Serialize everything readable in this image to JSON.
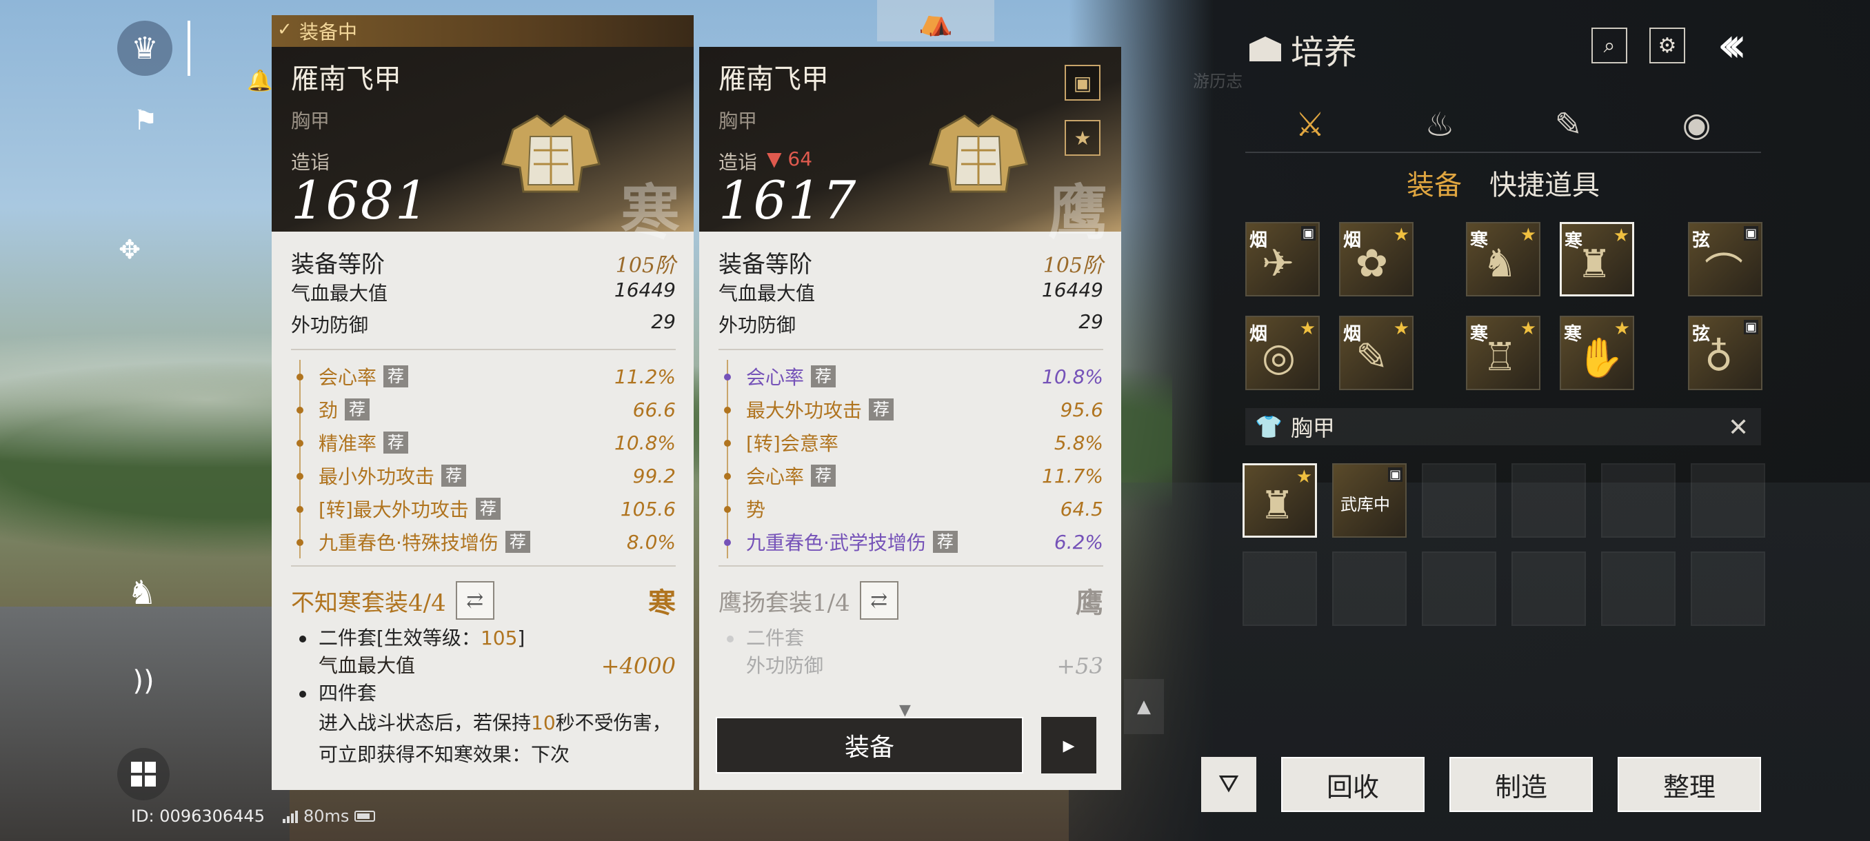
{
  "hud": {
    "player_id": "ID: 0096306445",
    "ping": "80ms"
  },
  "left_card": {
    "status": "装备中",
    "name": "雁南飞甲",
    "slot": "胸甲",
    "power_label": "造诣",
    "power": "1681",
    "seal": "寒",
    "tier_label": "装备等阶",
    "tier": "105阶",
    "base_stats": [
      {
        "k": "气血最大值",
        "v": "16449"
      },
      {
        "k": "外功防御",
        "v": "29"
      }
    ],
    "sub_stats": [
      {
        "k": "会心率",
        "v": "11.2%",
        "tag": "荐",
        "color": "gold"
      },
      {
        "k": "劲",
        "v": "66.6",
        "tag": "荐",
        "color": "gold"
      },
      {
        "k": "精准率",
        "v": "10.8%",
        "tag": "荐",
        "color": "gold"
      },
      {
        "k": "最小外功攻击",
        "v": "99.2",
        "tag": "荐",
        "color": "gold"
      },
      {
        "k": "[转]最大外功攻击",
        "v": "105.6",
        "tag": "荐",
        "color": "gold"
      },
      {
        "k": "九重春色·特殊技增伤",
        "v": "8.0%",
        "tag": "荐",
        "color": "gold"
      }
    ],
    "set_name": "不知寒套装4/4",
    "set_seal": "寒",
    "set_two": "二件套[生效等级：",
    "set_two_lvl": "105",
    "set_two_end": "]",
    "set_two_stat": "气血最大值",
    "set_two_val": "+4000",
    "set_four": "四件套",
    "set_four_desc_a": "进入战斗状态后，若保持",
    "set_four_desc_num": "10",
    "set_four_desc_b": "秒不受伤害，可立即获得不知寒效果：下次"
  },
  "right_card": {
    "name": "雁南飞甲",
    "slot": "胸甲",
    "power_label": "造诣",
    "power_delta": "▼ 64",
    "power": "1617",
    "seal": "鹰",
    "tier_label": "装备等阶",
    "tier": "105阶",
    "base_stats": [
      {
        "k": "气血最大值",
        "v": "16449"
      },
      {
        "k": "外功防御",
        "v": "29"
      }
    ],
    "sub_stats": [
      {
        "k": "会心率",
        "v": "10.8%",
        "tag": "荐",
        "color": "purple"
      },
      {
        "k": "最大外功攻击",
        "v": "95.6",
        "tag": "荐",
        "color": "gold"
      },
      {
        "k": "[转]会意率",
        "v": "5.8%",
        "tag": "",
        "color": "gold"
      },
      {
        "k": "会心率",
        "v": "11.7%",
        "tag": "荐",
        "color": "gold"
      },
      {
        "k": "势",
        "v": "64.5",
        "tag": "",
        "color": "gold"
      },
      {
        "k": "九重春色·武学技增伤",
        "v": "6.2%",
        "tag": "荐",
        "color": "purple"
      }
    ],
    "set_name": "鹰扬套装1/4",
    "set_seal": "鹰",
    "set_two": "二件套",
    "set_two_stat": "外功防御",
    "set_two_val": "+53",
    "equip_label": "装备"
  },
  "panel": {
    "title": "培养",
    "faint": "游历志",
    "sub_tabs": [
      "装备",
      "快捷道具"
    ],
    "category": "胸甲",
    "inv_label_storage": "武库中",
    "buttons": [
      "回收",
      "制造",
      "整理"
    ]
  },
  "slots": [
    {
      "ch": "烟",
      "mark": "rank"
    },
    {
      "ch": "烟",
      "mark": "star"
    },
    {
      "ch": "寒",
      "mark": "star"
    },
    {
      "ch": "寒",
      "mark": "star"
    },
    {
      "ch": "弦",
      "mark": "rank"
    },
    {
      "ch": "烟",
      "mark": "star"
    },
    {
      "ch": "烟",
      "mark": "star"
    },
    {
      "ch": "寒",
      "mark": "star"
    },
    {
      "ch": "寒",
      "mark": "star"
    },
    {
      "ch": "弦",
      "mark": "rank"
    }
  ],
  "colors": {
    "accent": "#e0a640",
    "gold_text": "#b0741f",
    "purple_text": "#7552b8",
    "loss": "#e05a4e"
  }
}
